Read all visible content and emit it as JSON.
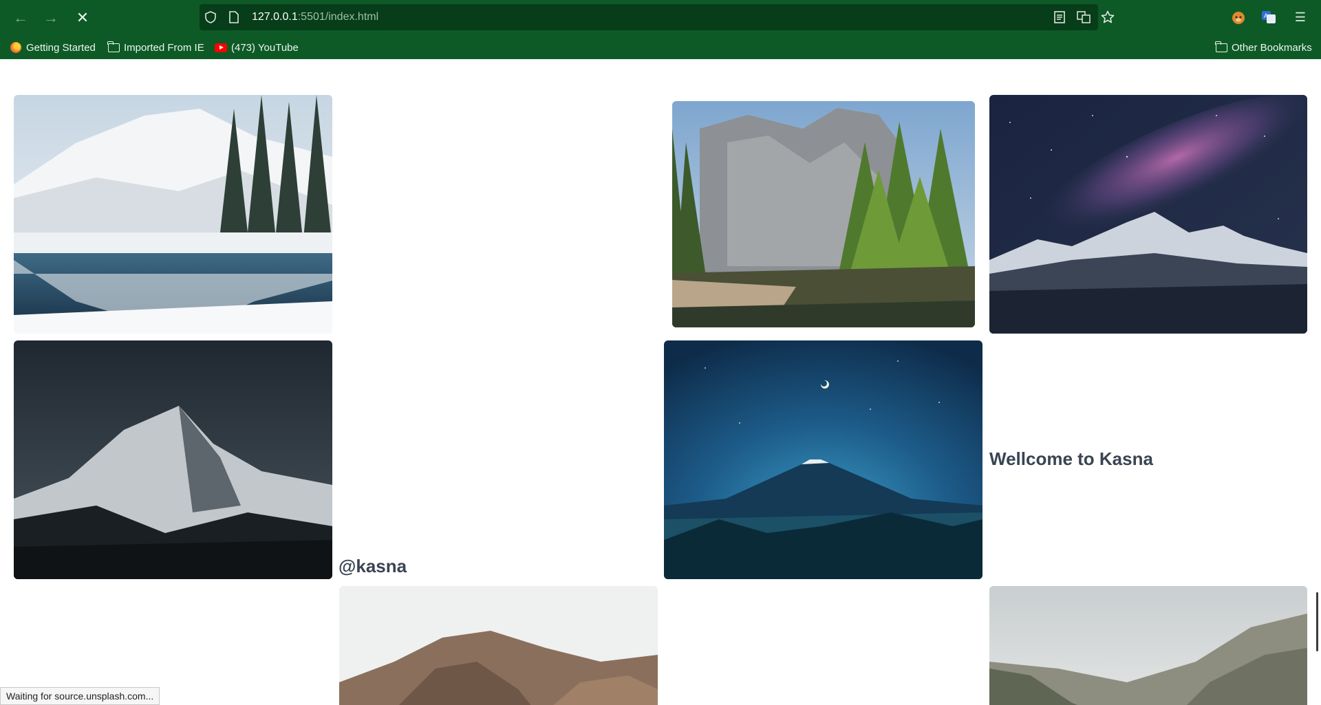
{
  "browser": {
    "url_host": "127.0.0.1",
    "url_rest": ":5501/index.html",
    "bookmarks": [
      {
        "label": "Getting Started",
        "icon": "firefox-icon"
      },
      {
        "label": "Imported From IE",
        "icon": "folder-icon"
      },
      {
        "label": "(473) YouTube",
        "icon": "youtube-icon"
      }
    ],
    "other_bookmarks": "Other Bookmarks",
    "status_text": "Waiting for source.unsplash.com..."
  },
  "page": {
    "handle": "@kasna",
    "welcome": "Wellcome to Kasna"
  },
  "colors": {
    "chrome": "#0d5a26",
    "urlbar": "#073d19",
    "heading": "#3a4452"
  }
}
